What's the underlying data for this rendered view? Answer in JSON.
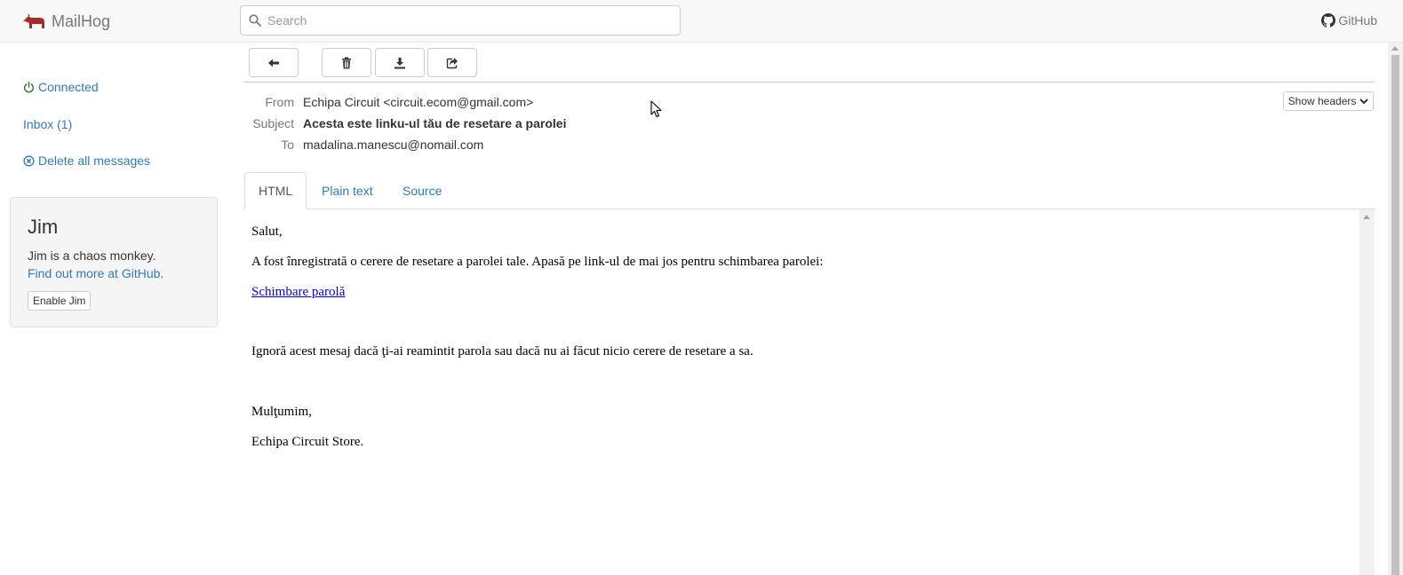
{
  "navbar": {
    "brand": "MailHog",
    "search_placeholder": "Search",
    "github_label": "GitHub"
  },
  "sidebar": {
    "connected": "Connected",
    "inbox": "Inbox (1)",
    "delete_all": "Delete all messages",
    "jim": {
      "title": "Jim",
      "description": "Jim is a chaos monkey.",
      "link": "Find out more at GitHub.",
      "button": "Enable Jim"
    }
  },
  "toolbar": {
    "buttons": [
      "back-arrow-icon",
      "trash-icon",
      "download-icon",
      "share-icon"
    ]
  },
  "message": {
    "headers": {
      "from_label": "From",
      "from": "Echipa Circuit <circuit.ecom@gmail.com>",
      "subject_label": "Subject",
      "subject": "Acesta este linku-ul tău de resetare a parolei",
      "to_label": "To",
      "to": "madalina.manescu@nomail.com"
    },
    "show_headers": "Show headers",
    "tabs": [
      "HTML",
      "Plain text",
      "Source"
    ],
    "active_tab": "HTML",
    "body": {
      "greeting": "Salut,",
      "line1": "A fost înregistrată o cerere de resetare a parolei tale. Apasă pe link-ul de mai jos pentru schimbarea parolei:",
      "reset_link": "Schimbare parolă",
      "line2": "Ignoră acest mesaj dacă ţi-ai reamintit parola sau dacă nu ai făcut nicio cerere de resetare a sa.",
      "thanks": "Mulţumim,",
      "signature": "Echipa Circuit Store."
    }
  },
  "colors": {
    "link": "#337ab7",
    "connected": "#3c763d",
    "brand_logo": "#a52a2a",
    "email_link": "#0000ee"
  }
}
